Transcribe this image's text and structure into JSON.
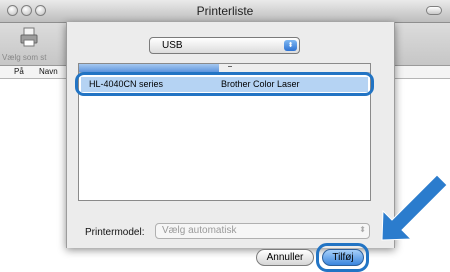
{
  "window": {
    "title": "Printerliste"
  },
  "toolbar": {
    "add_label": "Vælg som st"
  },
  "columns": {
    "on": "På",
    "name": "Navn"
  },
  "dialog": {
    "connection": "USB",
    "list_row": {
      "name": "HL-4040CN series",
      "kind": "Brother Color Laser"
    },
    "printer_model_label": "Printermodel:",
    "printer_model_value": "Vælg automatisk",
    "cancel_label": "Annuller",
    "add_label": "Tilføj"
  },
  "colors": {
    "accent": "#2274c4",
    "selection": "#b5d3f3"
  }
}
